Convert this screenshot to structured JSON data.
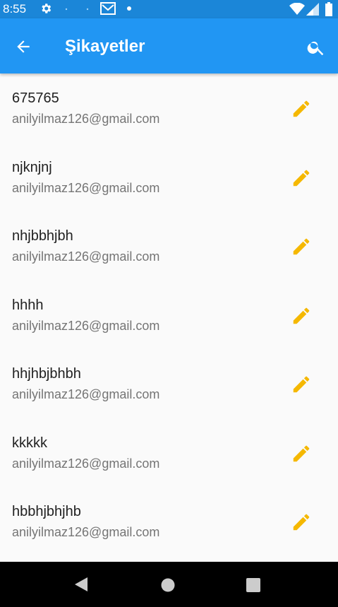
{
  "status_bar": {
    "time": "8:55",
    "icons": [
      "gear-icon",
      "gmail-icon",
      "wifi-icon",
      "signal-icon",
      "battery-icon"
    ]
  },
  "app_bar": {
    "title": "Şikayetler",
    "back_icon": "arrow-back-icon",
    "search_icon": "search-icon",
    "background": "#2196f3"
  },
  "complaints": [
    {
      "title": "675765",
      "email": "anilyilmaz126@gmail.com"
    },
    {
      "title": "njknjnj",
      "email": "anilyilmaz126@gmail.com"
    },
    {
      "title": "nhjbbhjbh",
      "email": "anilyilmaz126@gmail.com"
    },
    {
      "title": "hhhh",
      "email": "anilyilmaz126@gmail.com"
    },
    {
      "title": "hhjhbjbhbh",
      "email": "anilyilmaz126@gmail.com"
    },
    {
      "title": "kkkkk",
      "email": "anilyilmaz126@gmail.com"
    },
    {
      "title": "hbbhjbhjhb",
      "email": "anilyilmaz126@gmail.com"
    }
  ],
  "colors": {
    "edit_icon": "#f5b800",
    "status_bar": "#1b86d8"
  },
  "nav_bar": {
    "buttons": [
      "back-triangle-icon",
      "home-circle-icon",
      "recents-square-icon"
    ]
  }
}
